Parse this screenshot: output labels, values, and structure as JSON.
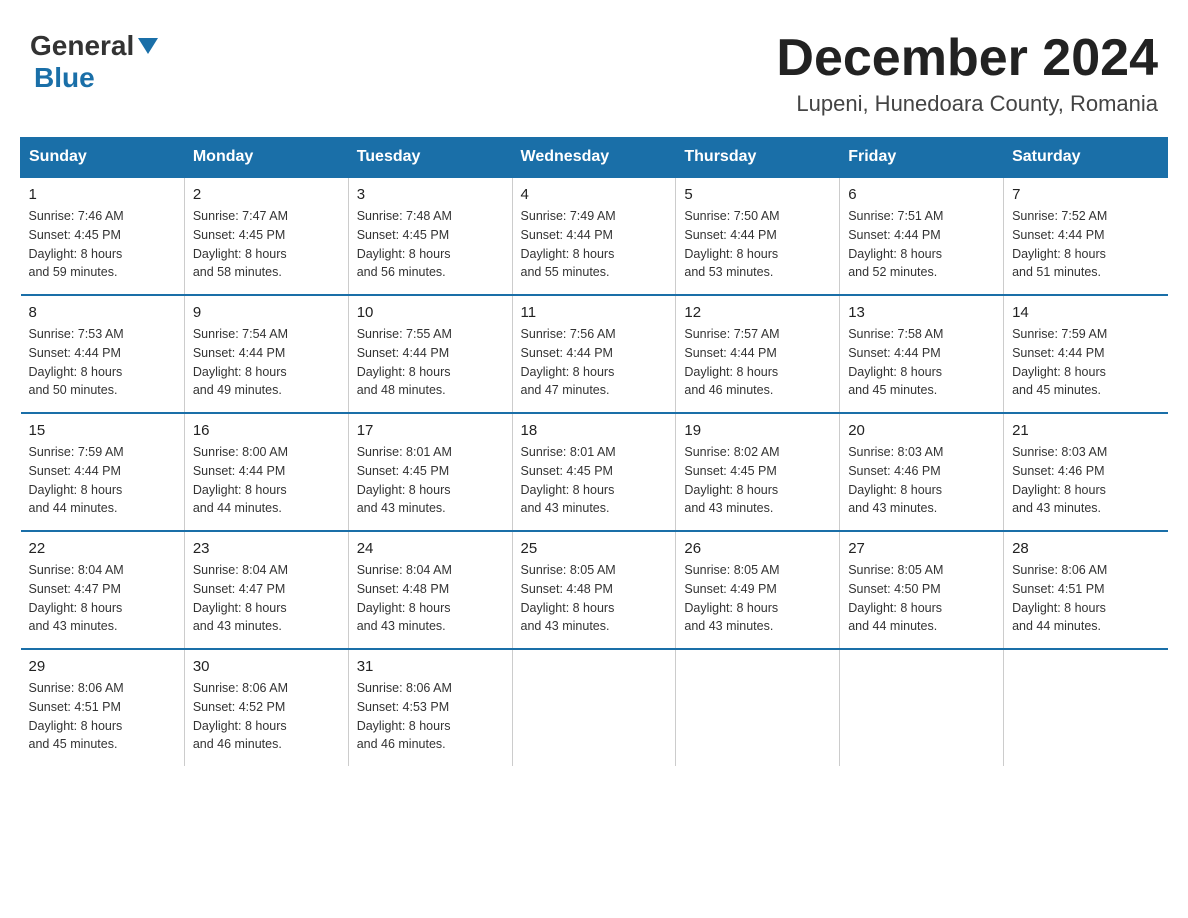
{
  "header": {
    "logo_general": "General",
    "logo_blue": "Blue",
    "month_title": "December 2024",
    "location": "Lupeni, Hunedoara County, Romania"
  },
  "weekdays": [
    "Sunday",
    "Monday",
    "Tuesday",
    "Wednesday",
    "Thursday",
    "Friday",
    "Saturday"
  ],
  "weeks": [
    [
      {
        "day": "1",
        "sunrise": "7:46 AM",
        "sunset": "4:45 PM",
        "daylight": "8 hours and 59 minutes."
      },
      {
        "day": "2",
        "sunrise": "7:47 AM",
        "sunset": "4:45 PM",
        "daylight": "8 hours and 58 minutes."
      },
      {
        "day": "3",
        "sunrise": "7:48 AM",
        "sunset": "4:45 PM",
        "daylight": "8 hours and 56 minutes."
      },
      {
        "day": "4",
        "sunrise": "7:49 AM",
        "sunset": "4:44 PM",
        "daylight": "8 hours and 55 minutes."
      },
      {
        "day": "5",
        "sunrise": "7:50 AM",
        "sunset": "4:44 PM",
        "daylight": "8 hours and 53 minutes."
      },
      {
        "day": "6",
        "sunrise": "7:51 AM",
        "sunset": "4:44 PM",
        "daylight": "8 hours and 52 minutes."
      },
      {
        "day": "7",
        "sunrise": "7:52 AM",
        "sunset": "4:44 PM",
        "daylight": "8 hours and 51 minutes."
      }
    ],
    [
      {
        "day": "8",
        "sunrise": "7:53 AM",
        "sunset": "4:44 PM",
        "daylight": "8 hours and 50 minutes."
      },
      {
        "day": "9",
        "sunrise": "7:54 AM",
        "sunset": "4:44 PM",
        "daylight": "8 hours and 49 minutes."
      },
      {
        "day": "10",
        "sunrise": "7:55 AM",
        "sunset": "4:44 PM",
        "daylight": "8 hours and 48 minutes."
      },
      {
        "day": "11",
        "sunrise": "7:56 AM",
        "sunset": "4:44 PM",
        "daylight": "8 hours and 47 minutes."
      },
      {
        "day": "12",
        "sunrise": "7:57 AM",
        "sunset": "4:44 PM",
        "daylight": "8 hours and 46 minutes."
      },
      {
        "day": "13",
        "sunrise": "7:58 AM",
        "sunset": "4:44 PM",
        "daylight": "8 hours and 45 minutes."
      },
      {
        "day": "14",
        "sunrise": "7:59 AM",
        "sunset": "4:44 PM",
        "daylight": "8 hours and 45 minutes."
      }
    ],
    [
      {
        "day": "15",
        "sunrise": "7:59 AM",
        "sunset": "4:44 PM",
        "daylight": "8 hours and 44 minutes."
      },
      {
        "day": "16",
        "sunrise": "8:00 AM",
        "sunset": "4:44 PM",
        "daylight": "8 hours and 44 minutes."
      },
      {
        "day": "17",
        "sunrise": "8:01 AM",
        "sunset": "4:45 PM",
        "daylight": "8 hours and 43 minutes."
      },
      {
        "day": "18",
        "sunrise": "8:01 AM",
        "sunset": "4:45 PM",
        "daylight": "8 hours and 43 minutes."
      },
      {
        "day": "19",
        "sunrise": "8:02 AM",
        "sunset": "4:45 PM",
        "daylight": "8 hours and 43 minutes."
      },
      {
        "day": "20",
        "sunrise": "8:03 AM",
        "sunset": "4:46 PM",
        "daylight": "8 hours and 43 minutes."
      },
      {
        "day": "21",
        "sunrise": "8:03 AM",
        "sunset": "4:46 PM",
        "daylight": "8 hours and 43 minutes."
      }
    ],
    [
      {
        "day": "22",
        "sunrise": "8:04 AM",
        "sunset": "4:47 PM",
        "daylight": "8 hours and 43 minutes."
      },
      {
        "day": "23",
        "sunrise": "8:04 AM",
        "sunset": "4:47 PM",
        "daylight": "8 hours and 43 minutes."
      },
      {
        "day": "24",
        "sunrise": "8:04 AM",
        "sunset": "4:48 PM",
        "daylight": "8 hours and 43 minutes."
      },
      {
        "day": "25",
        "sunrise": "8:05 AM",
        "sunset": "4:48 PM",
        "daylight": "8 hours and 43 minutes."
      },
      {
        "day": "26",
        "sunrise": "8:05 AM",
        "sunset": "4:49 PM",
        "daylight": "8 hours and 43 minutes."
      },
      {
        "day": "27",
        "sunrise": "8:05 AM",
        "sunset": "4:50 PM",
        "daylight": "8 hours and 44 minutes."
      },
      {
        "day": "28",
        "sunrise": "8:06 AM",
        "sunset": "4:51 PM",
        "daylight": "8 hours and 44 minutes."
      }
    ],
    [
      {
        "day": "29",
        "sunrise": "8:06 AM",
        "sunset": "4:51 PM",
        "daylight": "8 hours and 45 minutes."
      },
      {
        "day": "30",
        "sunrise": "8:06 AM",
        "sunset": "4:52 PM",
        "daylight": "8 hours and 46 minutes."
      },
      {
        "day": "31",
        "sunrise": "8:06 AM",
        "sunset": "4:53 PM",
        "daylight": "8 hours and 46 minutes."
      },
      null,
      null,
      null,
      null
    ]
  ],
  "labels": {
    "sunrise": "Sunrise:",
    "sunset": "Sunset:",
    "daylight": "Daylight:"
  }
}
